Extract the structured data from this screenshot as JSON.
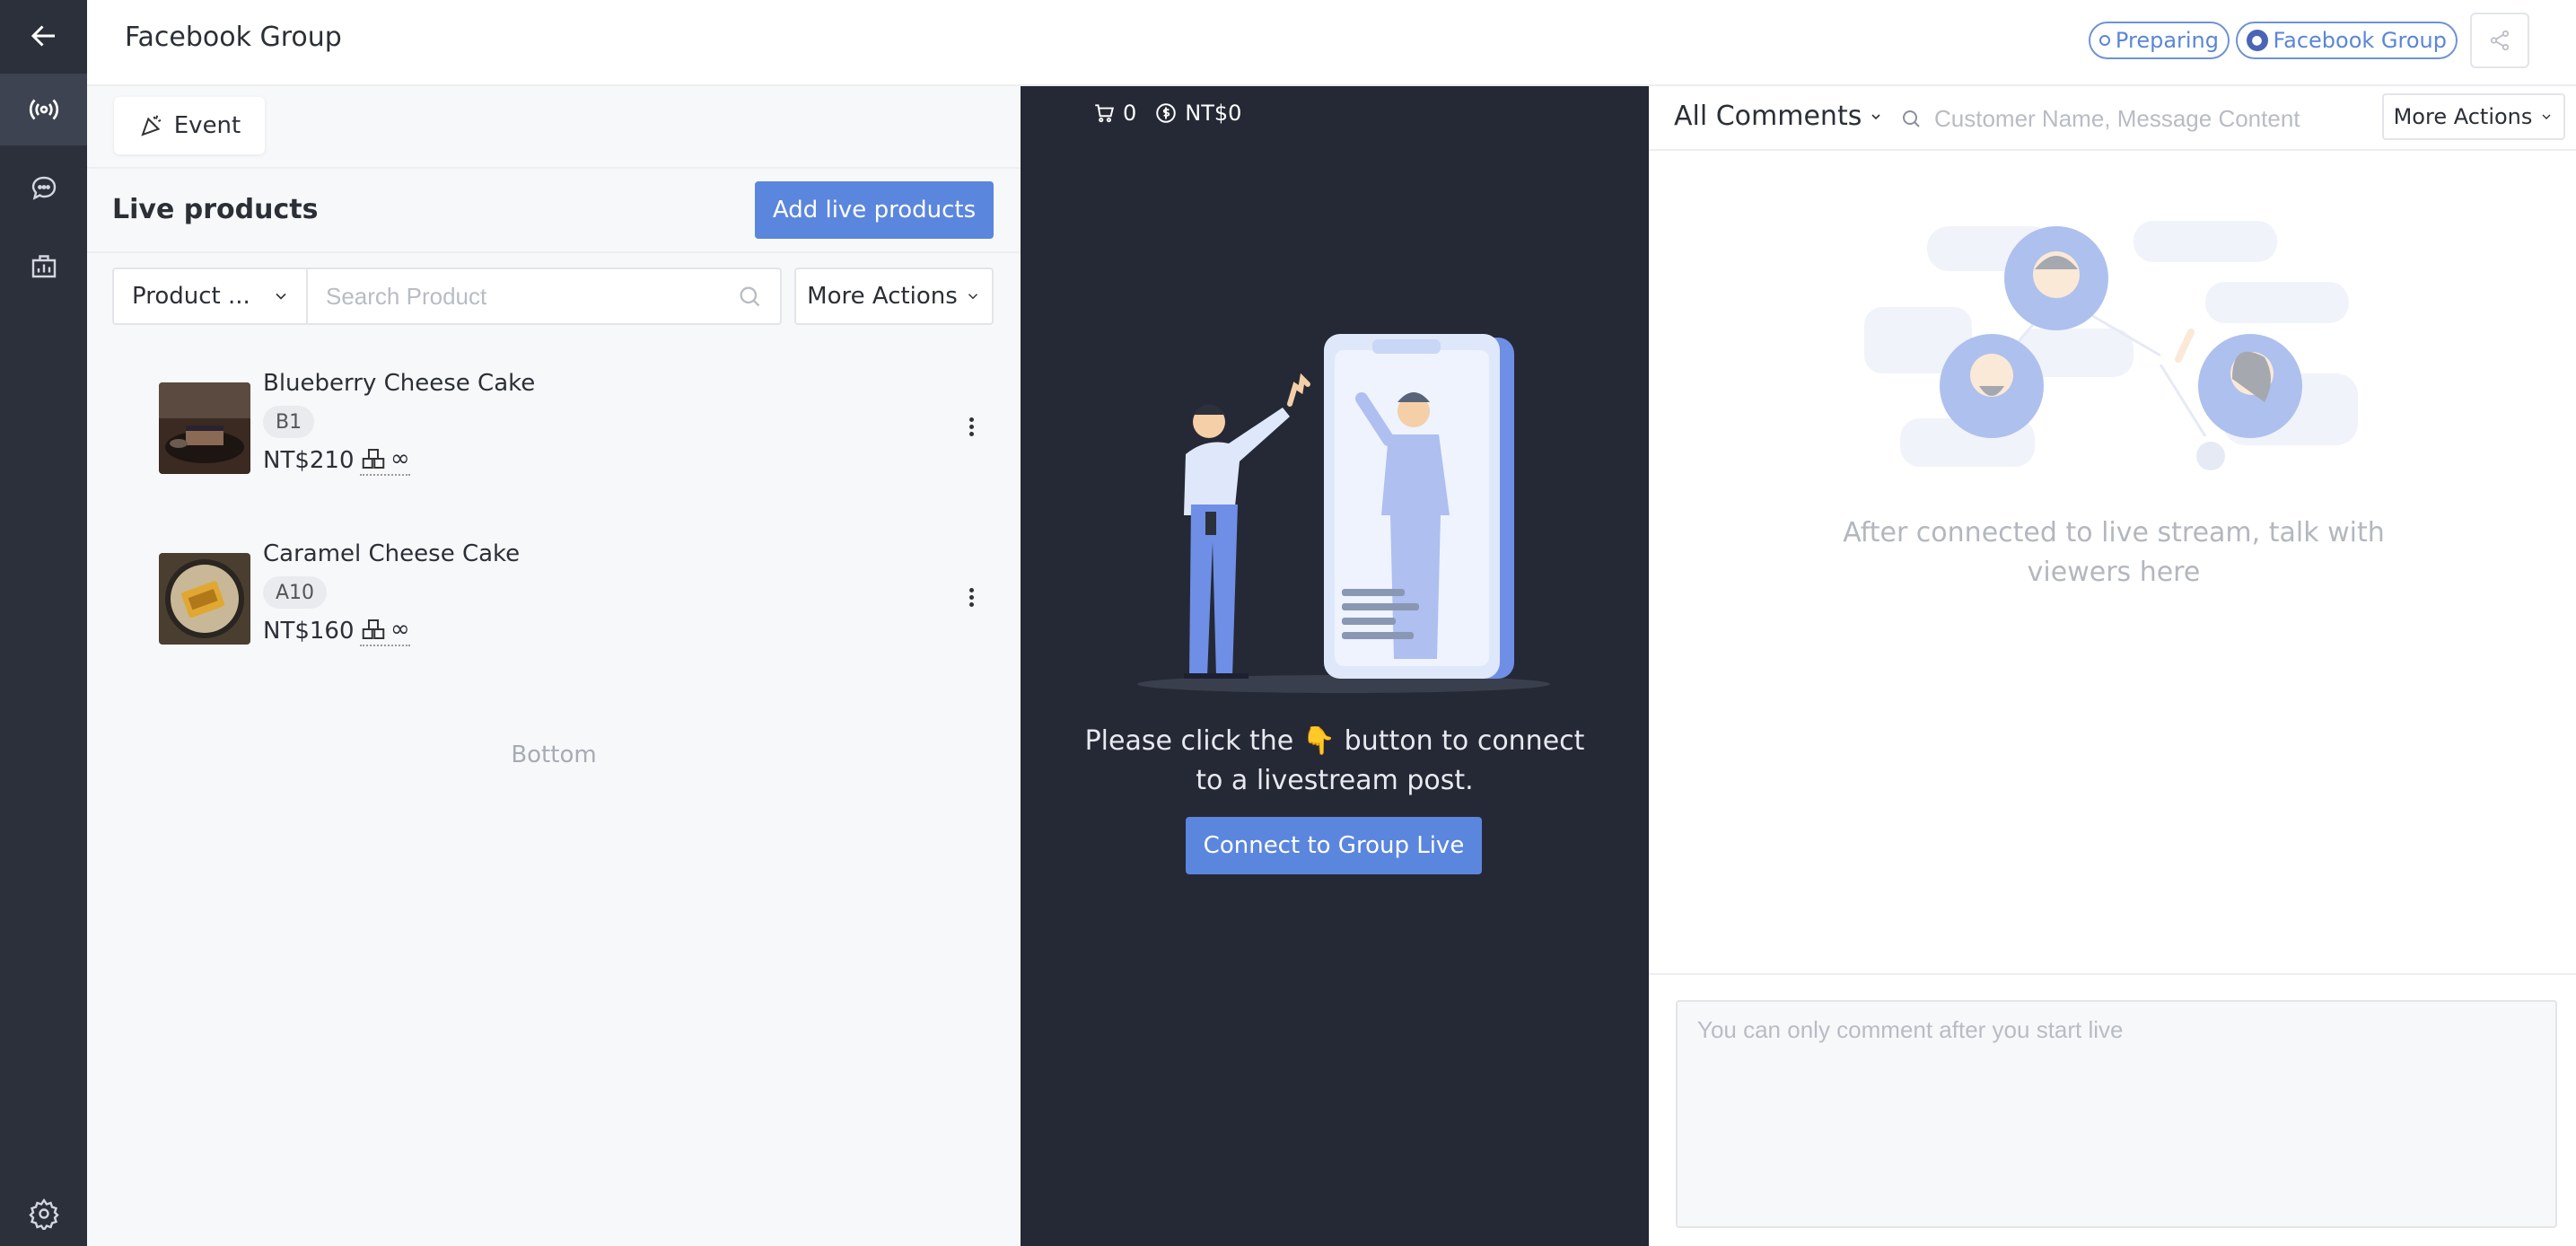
{
  "header": {
    "title": "Facebook Group",
    "status_badge": "Preparing",
    "platform_badge": "Facebook Group"
  },
  "left": {
    "event_label": "Event",
    "section_title": "Live products",
    "add_button": "Add live products",
    "filter_label": "Product ...",
    "search_placeholder": "Search Product",
    "more_actions": "More Actions",
    "products": [
      {
        "name": "Blueberry Cheese Cake",
        "code": "B1",
        "price": "NT$210",
        "stock": "∞"
      },
      {
        "name": "Caramel Cheese Cake",
        "code": "A10",
        "price": "NT$160",
        "stock": "∞"
      }
    ],
    "bottom_text": "Bottom"
  },
  "center": {
    "cart_count": "0",
    "total": "NT$0",
    "prompt_text": "Please click the 👇 button to connect to a livestream post.",
    "connect_button": "Connect to Group Live"
  },
  "right": {
    "filter_label": "All Comments",
    "search_placeholder": "Customer Name, Message Content",
    "more_actions": "More Actions",
    "empty_text": "After connected to live stream, talk with viewers here",
    "comment_placeholder": "You can only comment after you start live"
  },
  "colors": {
    "rail": "#2b303b",
    "accent": "#5b86de",
    "center_bg": "#252935"
  }
}
